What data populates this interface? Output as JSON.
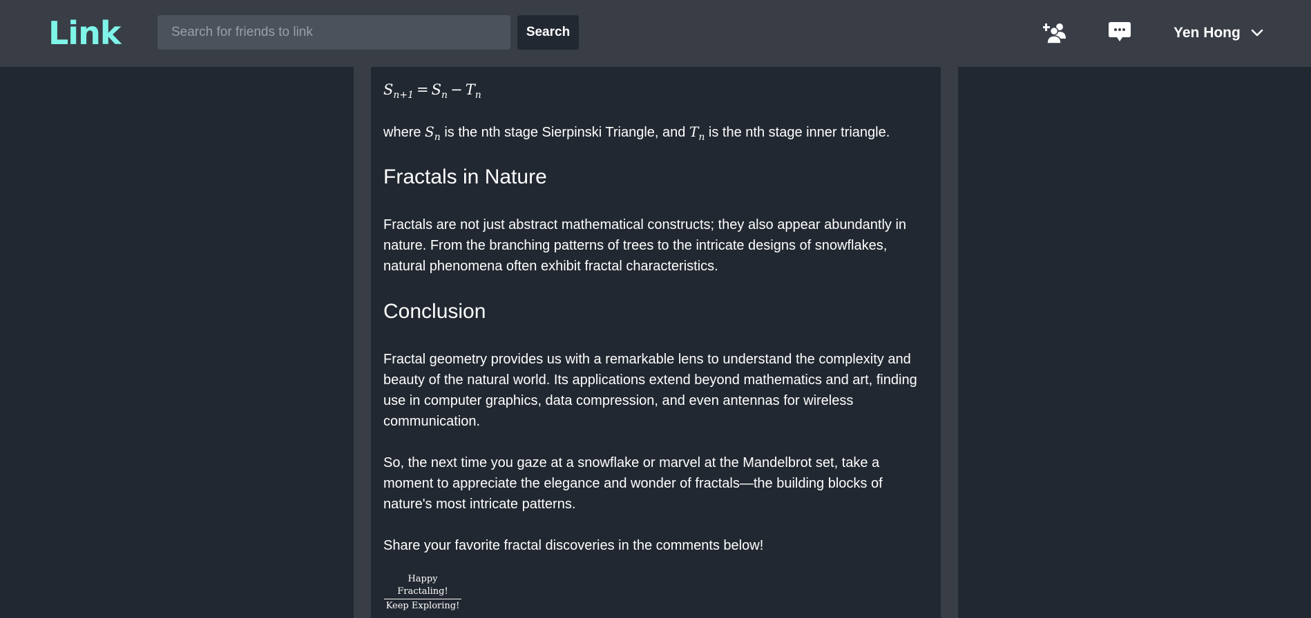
{
  "header": {
    "logo": "Link",
    "search_placeholder": "Search for friends to link",
    "search_button": "Search",
    "icons": {
      "friend": "add-friend-icon",
      "messages": "chat-icon",
      "menu": "chevron-down-icon"
    },
    "user_name": "Yen Hong"
  },
  "article": {
    "formula": {
      "lhs": "S",
      "lhs_sub": "n+1",
      "eq": "=",
      "a": "S",
      "a_sub": "n",
      "minus": "−",
      "b": "T",
      "b_sub": "n"
    },
    "where_text": {
      "p1": "where ",
      "s": "S",
      "s_sub": "n",
      "p2": " is the nth stage Sierpinski Triangle, and ",
      "t": "T",
      "t_sub": "n",
      "p3": " is the nth stage inner triangle."
    },
    "section_nature": {
      "heading": "Fractals in Nature",
      "body": "Fractals are not just abstract mathematical constructs; they also appear abundantly in nature. From the branching patterns of trees to the intricate designs of snowflakes, natural phenomena often exhibit fractal characteristics."
    },
    "section_conclusion": {
      "heading": "Conclusion",
      "body1": "Fractal geometry provides us with a remarkable lens to understand the complexity and beauty of the natural world. Its applications extend beyond mathematics and art, finding use in computer graphics, data compression, and even antennas for wireless communication.",
      "body2": "So, the next time you gaze at a snowflake or marvel at the Mandelbrot set, take a moment to appreciate the elegance and wonder of fractals—the building blocks of nature's most intricate patterns.",
      "body3": "Share your favorite fractal discoveries in the comments below!"
    },
    "signoff": {
      "top": "Happy Fractaling!",
      "bottom": "Keep Exploring!"
    }
  },
  "colors": {
    "background": "#222831",
    "header": "#393e46",
    "accent": "#7ff5e9",
    "input": "#4b525c",
    "text": "#ffffff"
  }
}
